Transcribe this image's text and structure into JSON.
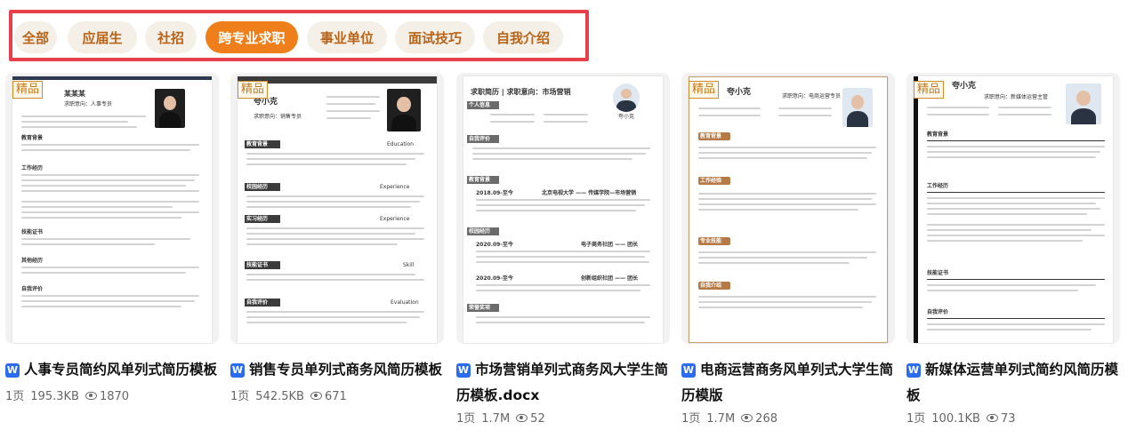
{
  "tabs": [
    {
      "label": "全部",
      "active": false
    },
    {
      "label": "应届生",
      "active": false
    },
    {
      "label": "社招",
      "active": false
    },
    {
      "label": "跨专业求职",
      "active": true
    },
    {
      "label": "事业单位",
      "active": false
    },
    {
      "label": "面试技巧",
      "active": false
    },
    {
      "label": "自我介绍",
      "active": false
    }
  ],
  "badge": "精品",
  "file_type_icon": "word-doc-icon",
  "colors": {
    "accent": "#ef7f1a",
    "tab_bg": "#f4efe7",
    "tab_text": "#b8641a",
    "highlight_frame": "#e8404b",
    "word_blue": "#2b6bed"
  },
  "cards": [
    {
      "title": "人事专员简约风单列式简历模板",
      "pages": "1页",
      "size": "195.3KB",
      "views": "1870",
      "preview": {
        "name": "某某某",
        "target": "求职意向：人事专员",
        "sections": [
          "教育背景",
          "工作经历",
          "技能证书",
          "其他经历",
          "自我评价"
        ]
      }
    },
    {
      "title": "销售专员单列式商务风简历模板",
      "pages": "1页",
      "size": "542.5KB",
      "views": "671",
      "preview": {
        "name": "夸小克",
        "target": "求职意向：销售专员",
        "sections": [
          "教育背景",
          "校园经历",
          "实习经历",
          "技能证书",
          "自我评价"
        ],
        "side_labels": [
          "Education",
          "Experience",
          "Experience",
          "Skill",
          "Evaluation"
        ]
      }
    },
    {
      "title": "市场营销单列式商务风大学生简历模板.docx",
      "pages": "1页",
      "size": "1.7M",
      "views": "52",
      "preview": {
        "name": "夸小克",
        "target": "求职简历 | 求职意向：市场营销",
        "sections": [
          "个人信息",
          "自我评价",
          "教育背景",
          "校园经历",
          "荣誉奖项"
        ],
        "entries": [
          "2018.09-至今",
          "北京电视大学 —— 传媒学院—市场营销",
          "2020.09-至今",
          "电子商务社团 —— 团长",
          "2020.09-至今",
          "创新组织社团 —— 团长"
        ]
      }
    },
    {
      "title": "电商运营商务风单列式大学生简历模版",
      "pages": "1页",
      "size": "1.7M",
      "views": "268",
      "preview": {
        "name": "夸小克",
        "target": "求职意向：电商运营专员",
        "sections": [
          "教育背景",
          "工作经验",
          "专业技能",
          "自我介绍"
        ]
      }
    },
    {
      "title": "新媒体运营单列式简约风简历模板",
      "pages": "1页",
      "size": "100.1KB",
      "views": "73",
      "preview": {
        "name": "夸小克",
        "target": "求职意向：新媒体运营主管",
        "sections": [
          "教育背景",
          "工作经历",
          "技能证书",
          "自我评价"
        ]
      }
    }
  ]
}
